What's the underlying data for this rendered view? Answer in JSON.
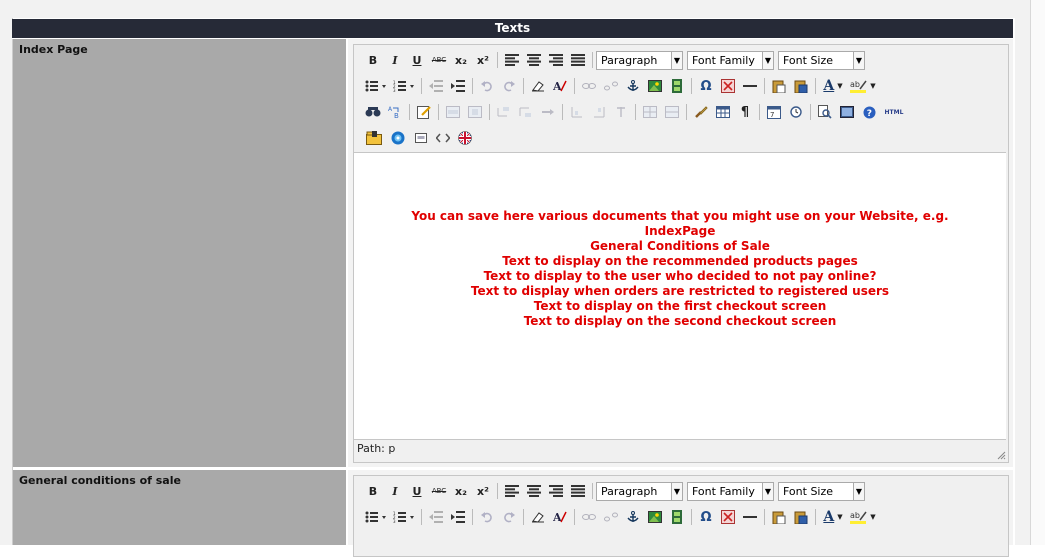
{
  "section_title": "Texts",
  "rows": [
    {
      "label": "Index Page"
    },
    {
      "label": "General conditions of sale"
    }
  ],
  "toolbar": {
    "bold": "B",
    "italic": "I",
    "underline": "U",
    "strike": "ABC",
    "subscript": "x₂",
    "superscript": "x²",
    "format_select": "Paragraph",
    "fontfamily_select": "Font Family",
    "fontsize_select": "Font Size",
    "html_button": "HTML",
    "pilcrow": "¶",
    "omega": "Ω",
    "textcolor": "A"
  },
  "editor1": {
    "content_lines": [
      "You can save here various documents that you might use on your Website, e.g.",
      "IndexPage",
      "General Conditions of Sale",
      "Text to display on the recommended products pages",
      "Text to display to the user who decided to not pay online?",
      "Text to display when orders are restricted to registered users",
      "Text to display on the first checkout screen",
      "Text to display on the second checkout screen"
    ],
    "path_label": "Path: p"
  },
  "colors": {
    "header_bg": "#262a37",
    "label_bg": "#a9a9a9",
    "content_text": "#e00000"
  }
}
